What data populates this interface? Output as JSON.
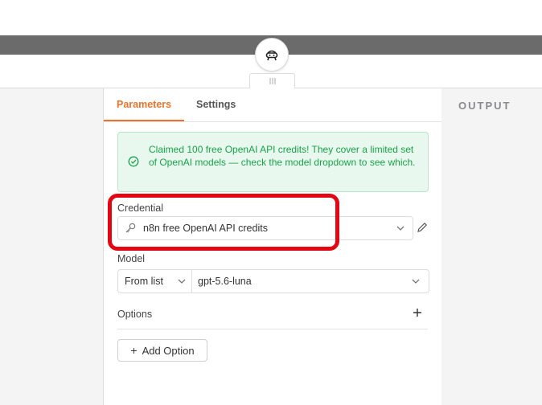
{
  "tabs": [
    {
      "label": "Parameters",
      "active": true
    },
    {
      "label": "Settings",
      "active": false
    }
  ],
  "output_panel": {
    "title": "OUTPUT"
  },
  "notice": {
    "text": "Claimed 100 free OpenAI API credits! They cover a limited set of OpenAI models — check the model dropdown to see which.",
    "icon": "check-circle-icon"
  },
  "credential": {
    "label": "Credential",
    "value": "n8n free OpenAI API credits",
    "icon": "key-icon",
    "edit_icon": "pencil-icon"
  },
  "model": {
    "label": "Model",
    "mode": "From list",
    "value": "gpt-5.6-luna"
  },
  "options": {
    "label": "Options",
    "add_label": "Add Option"
  },
  "colors": {
    "accent": "#e8742c",
    "success_text": "#17a34a",
    "success_bg": "#e9f8ee",
    "highlight": "#e30613",
    "top_bar": "#6b6b6b"
  }
}
